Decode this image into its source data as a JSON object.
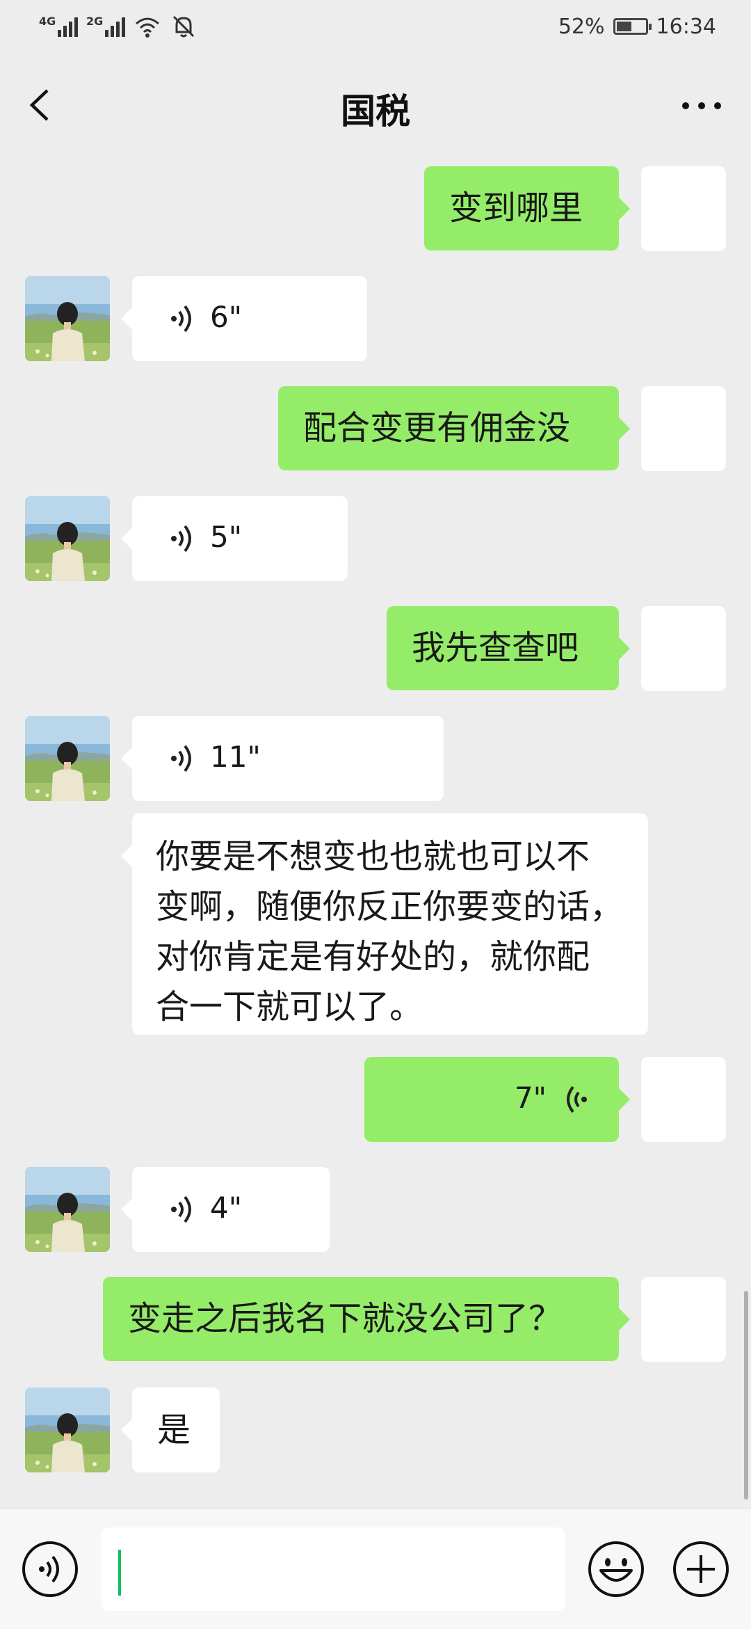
{
  "status_bar": {
    "net1_label": "4G",
    "net2_label": "2G",
    "battery_percent_text": "52%",
    "battery_level": 0.52,
    "time": "16:34"
  },
  "header": {
    "title": "国税"
  },
  "messages": [
    {
      "side": "out",
      "type": "text",
      "text": "变到哪里"
    },
    {
      "side": "in",
      "type": "voice",
      "duration": "6\""
    },
    {
      "side": "out",
      "type": "text",
      "text": "配合变更有佣金没"
    },
    {
      "side": "in",
      "type": "voice",
      "duration": "5\""
    },
    {
      "side": "out",
      "type": "text",
      "text": "我先查查吧"
    },
    {
      "side": "in",
      "type": "voice",
      "duration": "11\""
    },
    {
      "side": "in",
      "type": "text",
      "text": "你要是不想变也也就也可以不\n变啊，随便你反正你要变的话，\n对你肯定是有好处的，就你配\n合一下就可以了。"
    },
    {
      "side": "out",
      "type": "voice",
      "duration": "7\""
    },
    {
      "side": "in",
      "type": "voice",
      "duration": "4\""
    },
    {
      "side": "out",
      "type": "text",
      "text": "变走之后我名下就没公司了？"
    },
    {
      "side": "in",
      "type": "text",
      "text": "是"
    }
  ],
  "input": {
    "value": ""
  },
  "icons": {
    "back": "back-arrow-icon",
    "more": "more-dots-icon",
    "voice": "voice-wave-icon",
    "emoji": "emoji-icon",
    "plus": "plus-icon"
  },
  "colors": {
    "background": "#ededed",
    "outgoing_bubble": "#95ec69",
    "incoming_bubble": "#ffffff",
    "cursor": "#07c160"
  }
}
